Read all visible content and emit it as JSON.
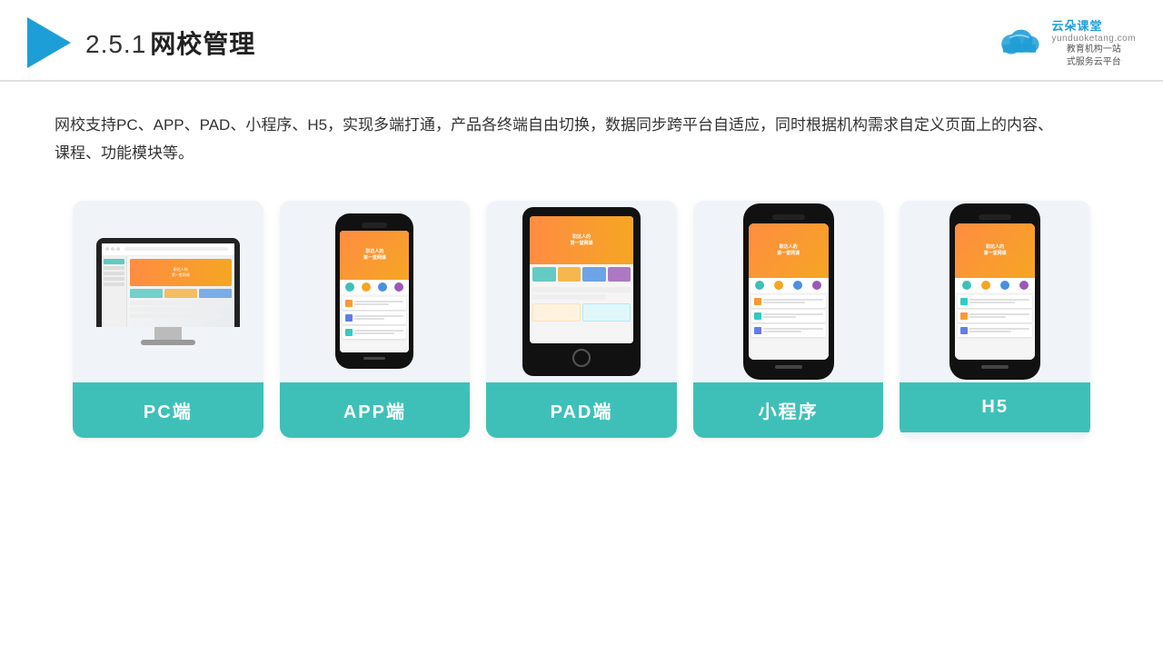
{
  "header": {
    "section_number": "2.5.1",
    "title": "网校管理",
    "brand_name": "云朵课堂",
    "brand_url": "yunduoketang.com",
    "brand_slogan": "教育机构一站\n式服务云平台"
  },
  "description": "网校支持PC、APP、PAD、小程序、H5，实现多端打通，产品各终端自由切换，数据同步跨平台自适应，同时根据机构需求自定义页面上的内容、课程、功能模块等。",
  "cards": [
    {
      "id": "pc",
      "label": "PC端",
      "type": "monitor"
    },
    {
      "id": "app",
      "label": "APP端",
      "type": "app-phone"
    },
    {
      "id": "pad",
      "label": "PAD端",
      "type": "tablet"
    },
    {
      "id": "mini",
      "label": "小程序",
      "type": "phone"
    },
    {
      "id": "h5",
      "label": "H5",
      "type": "phone2"
    }
  ]
}
